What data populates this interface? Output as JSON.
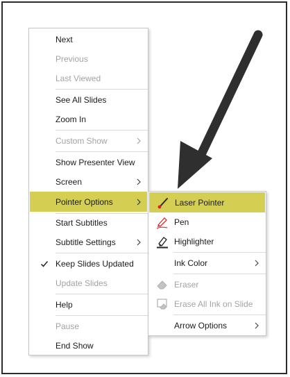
{
  "main_menu": {
    "next": "Next",
    "previous": "Previous",
    "last_viewed": "Last Viewed",
    "see_all_slides": "See All Slides",
    "zoom_in": "Zoom In",
    "custom_show": "Custom Show",
    "show_presenter_view": "Show Presenter View",
    "screen": "Screen",
    "pointer_options": "Pointer Options",
    "start_subtitles": "Start Subtitles",
    "subtitle_settings": "Subtitle Settings",
    "keep_slides_updated": "Keep Slides Updated",
    "update_slides": "Update Slides",
    "help": "Help",
    "pause": "Pause",
    "end_show": "End Show"
  },
  "pointer_submenu": {
    "laser_pointer": "Laser Pointer",
    "pen": "Pen",
    "highlighter": "Highlighter",
    "ink_color": "Ink Color",
    "eraser": "Eraser",
    "erase_all_ink": "Erase All Ink on Slide",
    "arrow_options": "Arrow Options"
  },
  "colors": {
    "highlight": "#d4cf52",
    "disabled_text": "#a3a3a3",
    "annotation_arrow": "#2f2f2f",
    "pen_red": "#d62c2c"
  }
}
